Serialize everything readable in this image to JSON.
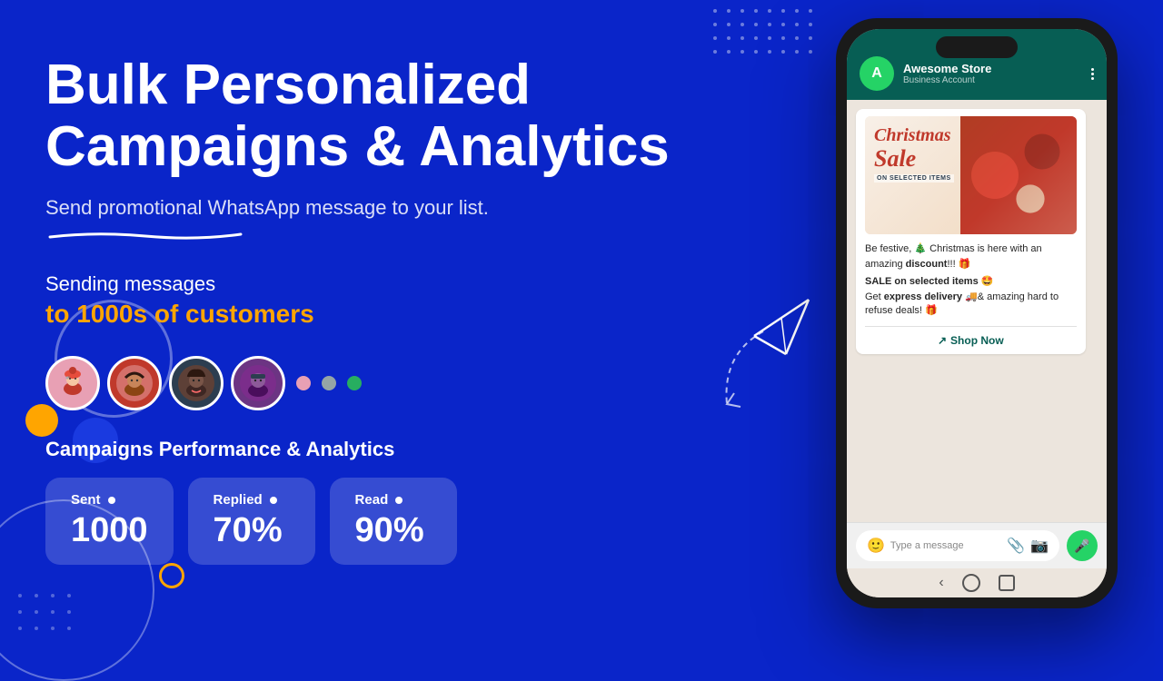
{
  "hero": {
    "title_line1": "Bulk Personalized",
    "title_line2": "Campaigns & Analytics",
    "subtitle": "Send promotional WhatsApp message to your list.",
    "sending_label": "Sending messages",
    "customers_label": "to 1000s of customers"
  },
  "analytics": {
    "section_title": "Campaigns Performance & Analytics",
    "stats": [
      {
        "label": "Sent",
        "value": "1000"
      },
      {
        "label": "Replied",
        "value": "70%"
      },
      {
        "label": "Read",
        "value": "90%"
      }
    ]
  },
  "phone": {
    "store_name": "Awesome Store",
    "store_status": "Business Account",
    "store_initial": "A",
    "message": {
      "festive_text": "Be festive, 🎄 Christmas is here with an amazing",
      "bold1": "discount",
      "discount_suffix": "!!! 🎁",
      "sale_line": "SALE on selected items 🤩",
      "delivery_text": "Get",
      "bold_delivery": "express delivery",
      "delivery_suffix": "🚚& amazing hard to refuse deals! 🎁",
      "shop_now": "Shop Now"
    },
    "input_placeholder": "Type a message",
    "banner": {
      "line1": "Christmas",
      "line2": "Sale",
      "line3": "ON SELECTED ITEMS"
    }
  },
  "colors": {
    "background": "#0a25c9",
    "orange": "#FFA500",
    "green": "#25d366",
    "whatsapp_header": "#075e54"
  }
}
